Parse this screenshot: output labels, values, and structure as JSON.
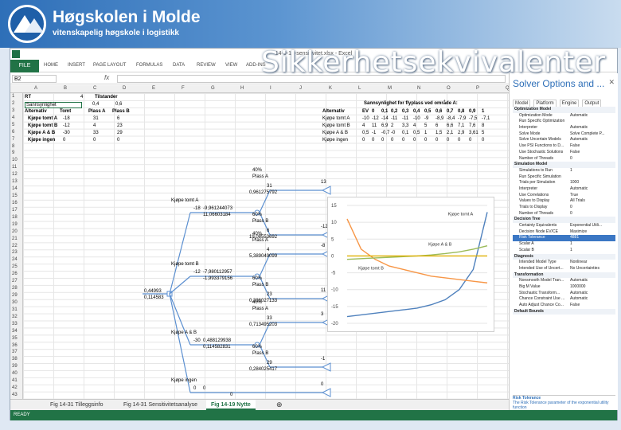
{
  "header": {
    "institution": "Høgskolen i Molde",
    "subtitle": "vitenskapelig høgskole i logistikk",
    "slide_title": "Sikkerhetsekvivalenter"
  },
  "window": {
    "title": "14-9-18-sensitivitet.xlsx - Excel"
  },
  "ribbon": {
    "file": "FILE",
    "tabs": [
      "HOME",
      "INSERT",
      "PAGE LAYOUT",
      "FORMULAS",
      "DATA",
      "REVIEW",
      "VIEW",
      "ADD-INS"
    ]
  },
  "formula_bar": {
    "name_box": "B2",
    "fx": "fx",
    "content": ""
  },
  "columns": [
    "A",
    "B",
    "C",
    "D",
    "E",
    "F",
    "G",
    "H",
    "I",
    "J",
    "K",
    "L",
    "M",
    "N",
    "O",
    "P",
    "Q"
  ],
  "table1": {
    "r1": [
      "RT",
      "4",
      "Tilstander"
    ],
    "r2": [
      "Sannsynlighet",
      "0,4",
      "0,6"
    ],
    "header": [
      "Alternativ",
      "Tomt",
      "Plass A",
      "Plass B"
    ],
    "rows": [
      [
        "Kjøpe tomt A",
        "-18",
        "31",
        "6"
      ],
      [
        "Kjøpe tomt B",
        "-12",
        "4",
        "23"
      ],
      [
        "Kjøpe A & B",
        "-30",
        "33",
        "29"
      ],
      [
        "Kjøpe ingen",
        "0",
        "0",
        "0"
      ]
    ]
  },
  "table2": {
    "title": "Sannsynlighet for flyplass ved område A:",
    "header": [
      "Alternativ",
      "EV",
      "0",
      "0,1",
      "0,2",
      "0,3",
      "0,4",
      "0,5",
      "0,6",
      "0,7",
      "0,8",
      "0,9",
      "1"
    ],
    "rows": [
      [
        "Kjøpe tomt A",
        "-10",
        "-12",
        "-14",
        "-11",
        "-11",
        "-10",
        "-9",
        "-8,9",
        "-8,4",
        "-7,9",
        "-7,5",
        "-7,1"
      ],
      [
        "Kjøpe tomt B",
        "4",
        "11",
        "6,9",
        "2",
        "3,3",
        "4",
        "5",
        "6",
        "6,6",
        "7,1",
        "7,6",
        "8"
      ],
      [
        "Kjøpe A & B",
        "0,5",
        "-1",
        "-0,7",
        "-0",
        "0,1",
        "0,5",
        "1",
        "1,5",
        "2,1",
        "2,9",
        "3,61",
        "5"
      ],
      [
        "Kjøpe ingen",
        "0",
        "0",
        "0",
        "0",
        "0",
        "0",
        "0",
        "0",
        "0",
        "0",
        "0",
        "0"
      ]
    ]
  },
  "tree": {
    "root_values": [
      "0,44993",
      "0,114583"
    ],
    "branches": [
      {
        "label": "Kjøpe tomt A",
        "cost": "-18",
        "values": [
          "-9,961244073",
          "11,06603184"
        ],
        "outcomes": [
          {
            "prob": "40%",
            "name": "Plass A",
            "pay": "31",
            "end": "13",
            "v": "0,961275792"
          },
          {
            "prob": "60%",
            "name": "Plass B",
            "pay": "6",
            "end": "-12",
            "v": "19,08553692"
          }
        ]
      },
      {
        "label": "Kjøpe tomt B",
        "cost": "-12",
        "values": [
          "-7,980112957",
          "-1,993379156"
        ],
        "outcomes": [
          {
            "prob": "40%",
            "name": "Plass A",
            "pay": "4",
            "end": "-8",
            "v": "5,389049099"
          },
          {
            "prob": "60%",
            "name": "Plass B",
            "pay": "23",
            "end": "11",
            "v": "0,336027133"
          }
        ]
      },
      {
        "label": "Kjøpe A & B",
        "cost": "-30",
        "values": [
          "0,488129938",
          "0,114582831"
        ],
        "outcomes": [
          {
            "prob": "40%",
            "name": "Plass A",
            "pay": "33",
            "end": "3",
            "v": "0,713495203"
          },
          {
            "prob": "60%",
            "name": "Plass B",
            "pay": "29",
            "end": "-1",
            "v": "0,284025417"
          }
        ]
      },
      {
        "label": "Kjøpe ingen",
        "cost": "0",
        "values": [
          "0"
        ],
        "outcomes": []
      }
    ],
    "end_zero": "0"
  },
  "chart_data": {
    "type": "line",
    "x": [
      0,
      0.1,
      0.2,
      0.3,
      0.4,
      0.5,
      0.6,
      0.7,
      0.8,
      0.9,
      1
    ],
    "xlim": [
      0,
      1
    ],
    "ylim": [
      -20,
      15
    ],
    "ytick_labels": [
      "15",
      "10",
      "5",
      "0",
      "-5",
      "-10",
      "-15",
      "-20"
    ],
    "series": [
      {
        "name": "Kjøpe tomt A",
        "color": "#4f81bd",
        "values": [
          -18,
          -17.5,
          -17,
          -16.5,
          -16,
          -15.5,
          -14.5,
          -13,
          -10,
          -4,
          13
        ]
      },
      {
        "name": "Kjøpe tomt B",
        "color": "#f79646",
        "values": [
          11,
          2,
          -1,
          -3,
          -4,
          -5,
          -6,
          -6.5,
          -7,
          -7.5,
          -8
        ]
      },
      {
        "name": "Kjøpe A & B",
        "color": "#9bbb59",
        "values": [
          -1,
          -0.8,
          -0.6,
          -0.4,
          -0.2,
          0,
          0.3,
          0.7,
          1.2,
          2,
          3
        ]
      },
      {
        "name": "Kjøpe ingen",
        "color": "#e0b000",
        "values": [
          0,
          0,
          0,
          0,
          0,
          0,
          0,
          0,
          0,
          0,
          0
        ]
      }
    ]
  },
  "sheet_tabs": [
    "Fig 14-31 Tilleggsinfo",
    "Fig 14-31 Sensitivitetsanalyse",
    "Fig 14-19 Nytte"
  ],
  "status": "READY",
  "solver": {
    "title": "Solver Options and ...",
    "tabs": [
      "Model",
      "Platform",
      "Engine",
      "Output"
    ],
    "rows": [
      {
        "k": "Optimization Model",
        "v": "",
        "sec": true
      },
      {
        "k": "Optimization Mode",
        "v": "Automatic"
      },
      {
        "k": "Run Specific Optimization",
        "v": ""
      },
      {
        "k": "Interpreter",
        "v": "Automatic"
      },
      {
        "k": "Solve Mode",
        "v": "Solve Complete P..."
      },
      {
        "k": "Solve Uncertain Models",
        "v": "Automatic"
      },
      {
        "k": "Use PSI Functions to D...",
        "v": "False"
      },
      {
        "k": "Use Stochastic Solutions",
        "v": "False"
      },
      {
        "k": "Number of Threads",
        "v": "0"
      },
      {
        "k": "Simulation Model",
        "v": "",
        "sec": true
      },
      {
        "k": "Simulations to Run",
        "v": "1"
      },
      {
        "k": "Run Specific Simulation",
        "v": ""
      },
      {
        "k": "Trials per Simulation",
        "v": "1000"
      },
      {
        "k": "Interpreter",
        "v": "Automatic"
      },
      {
        "k": "Use Correlations",
        "v": "True"
      },
      {
        "k": "Values to Display",
        "v": "All Trials"
      },
      {
        "k": "Trials to Display",
        "v": "0"
      },
      {
        "k": "Number of Threads",
        "v": "0"
      },
      {
        "k": "Decision Tree",
        "v": "",
        "sec": true
      },
      {
        "k": "Certainty Equivalents",
        "v": "Exponential Utili..."
      },
      {
        "k": "Decision Node EV/CE",
        "v": "Maximize"
      },
      {
        "k": "Risk Tolerance",
        "v": "4881",
        "sel": true
      },
      {
        "k": "Scalar A",
        "v": "1"
      },
      {
        "k": "Scalar B",
        "v": "1"
      },
      {
        "k": "Diagnosis",
        "v": "",
        "sec": true
      },
      {
        "k": "Intended Model Type",
        "v": "Nonlinear"
      },
      {
        "k": "Intended Use of Uncert...",
        "v": "No Uncertainties"
      },
      {
        "k": "Transformation",
        "v": "",
        "sec": true
      },
      {
        "k": "Nonsmooth Model Tran...",
        "v": "Automatic"
      },
      {
        "k": "Big M Value",
        "v": "1000000"
      },
      {
        "k": "Stochastic Transform...",
        "v": "Automatic"
      },
      {
        "k": "Chance Constraint Use ...",
        "v": "Automatic"
      },
      {
        "k": "Auto Adjust Chance Co...",
        "v": "False"
      },
      {
        "k": "Default Bounds",
        "v": "",
        "sec": true
      }
    ],
    "desc_title": "Risk Tolerance",
    "desc_text": "The Risk Tolerance parameter of the exponential utility function"
  }
}
